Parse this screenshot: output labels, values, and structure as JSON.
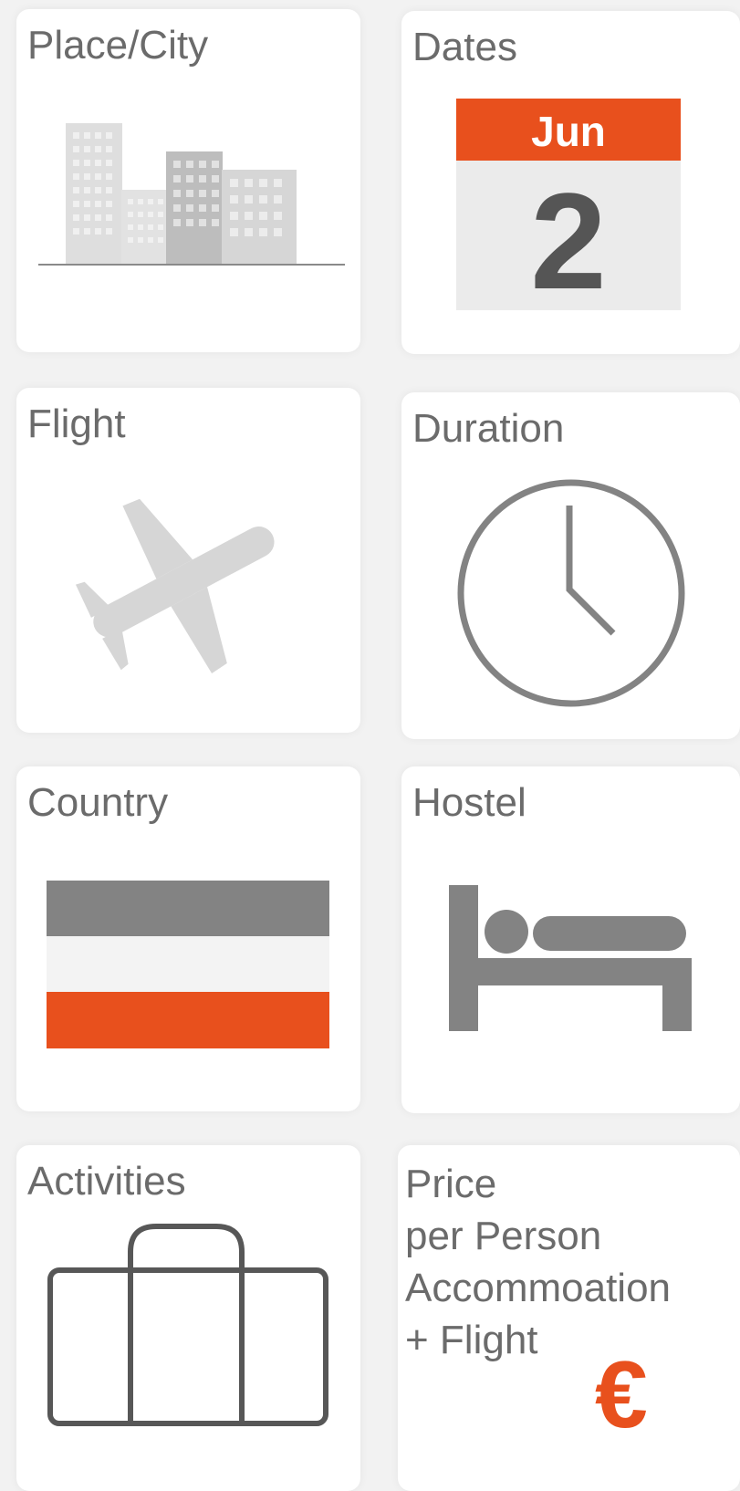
{
  "cards": {
    "place_city": {
      "label": "Place/City",
      "icon": "city-buildings-icon"
    },
    "dates": {
      "label": "Dates",
      "icon": "calendar-icon",
      "calendar_month": "Jun",
      "calendar_day": "2"
    },
    "flight": {
      "label": "Flight",
      "icon": "airplane-icon"
    },
    "duration": {
      "label": "Duration",
      "icon": "clock-icon"
    },
    "country": {
      "label": "Country",
      "icon": "flag-icon"
    },
    "hostel": {
      "label": "Hostel",
      "icon": "bed-icon"
    },
    "activities": {
      "label": "Activities",
      "icon": "suitcase-icon"
    },
    "price": {
      "label_lines": [
        "Price",
        "per Person",
        "Accommoation",
        "+ Flight"
      ],
      "icon": "euro-icon",
      "currency_symbol": "€"
    }
  },
  "colors": {
    "accent": "#e8501d",
    "icon_gray": "#838383",
    "icon_light_gray": "#d6d6d6",
    "text": "#6b6b6b",
    "card_bg": "#ffffff",
    "page_bg": "#f2f2f2"
  }
}
